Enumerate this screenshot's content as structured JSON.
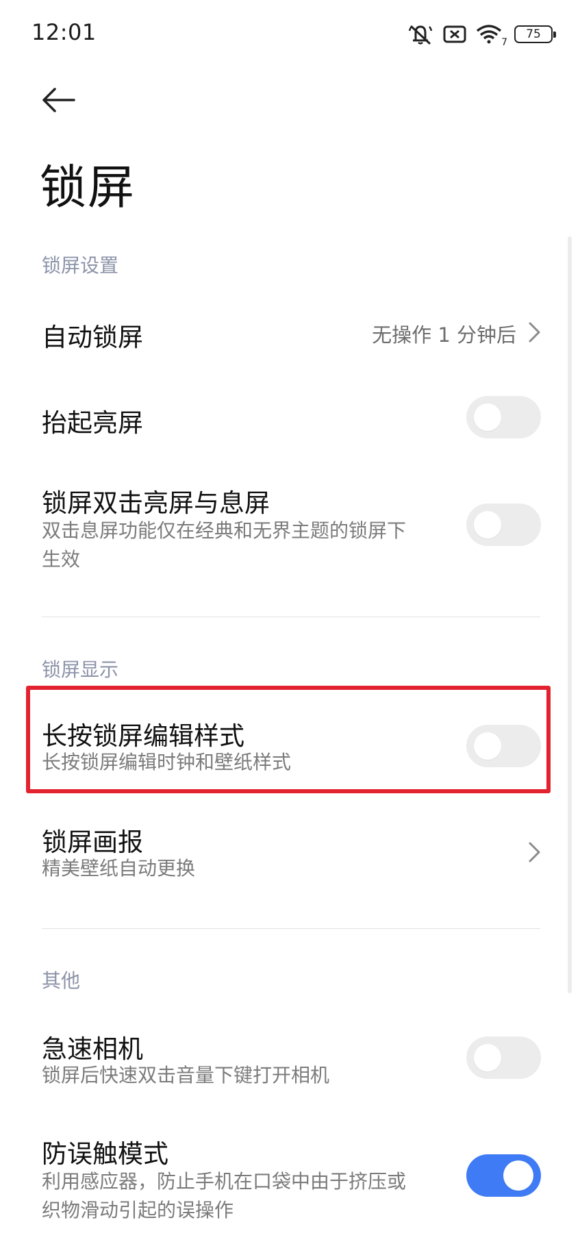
{
  "status_bar": {
    "time": "12:01",
    "wifi_badge": "7",
    "battery_level": "75",
    "icons": [
      "mute-bell-icon",
      "sim-x-icon",
      "wifi-icon",
      "battery-icon"
    ]
  },
  "header": {
    "back_icon": "arrow-left-icon",
    "title": "锁屏"
  },
  "sections": {
    "lock_settings": {
      "header": "锁屏设置",
      "auto_lock": {
        "title": "自动锁屏",
        "value": "无操作 1 分钟后"
      },
      "raise_to_wake": {
        "title": "抬起亮屏",
        "enabled": false
      },
      "double_tap": {
        "title": "锁屏双击亮屏与息屏",
        "subtitle_line1": "双击息屏功能仅在经典和无界主题的锁屏下",
        "subtitle_line2": "生效",
        "enabled": false
      }
    },
    "lock_display": {
      "header": "锁屏显示",
      "long_press_edit": {
        "title": "长按锁屏编辑样式",
        "subtitle": "长按锁屏编辑时钟和壁纸样式",
        "enabled": false
      },
      "wallpaper_carousel": {
        "title": "锁屏画报",
        "subtitle": "精美壁纸自动更换"
      }
    },
    "other": {
      "header": "其他",
      "quick_camera": {
        "title": "急速相机",
        "subtitle": "锁屏后快速双击音量下键打开相机",
        "enabled": false
      },
      "pocket_mode": {
        "title": "防误触模式",
        "subtitle_line1": "利用感应器，防止手机在口袋中由于挤压或",
        "subtitle_line2": "织物滑动引起的误操作",
        "enabled": true
      }
    }
  },
  "colors": {
    "accent": "#3f7bf5",
    "highlight": "#e2222f",
    "section_header": "#8c93a8",
    "toggle_off": "#ececec"
  }
}
